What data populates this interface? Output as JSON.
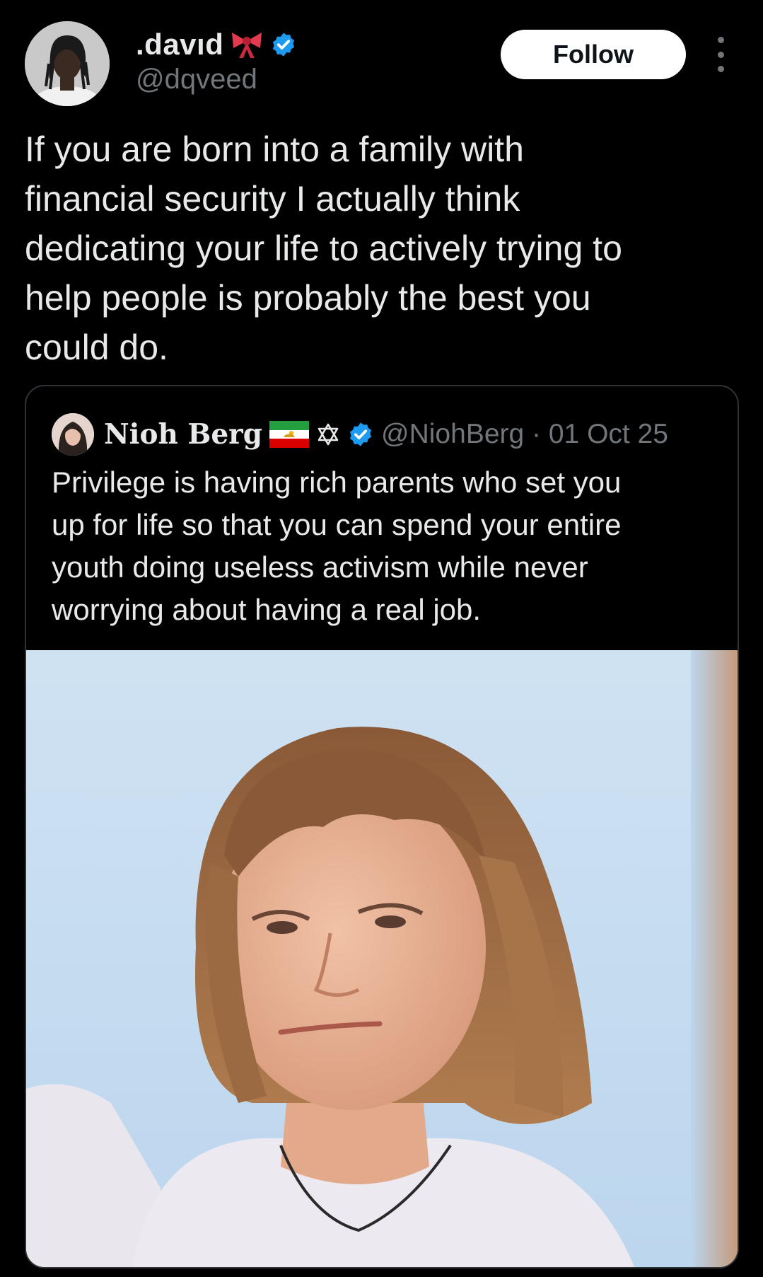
{
  "post": {
    "author": {
      "display_name": ".davıd",
      "handle": "@dqveed",
      "emoji_icon": "ribbon-bow-icon",
      "verified_icon": "verified-badge-icon"
    },
    "follow_label": "Follow",
    "more_icon": "more-vertical-icon",
    "text": "If you are born into a family with\nfinancial security I actually think\ndedicating your life to actively trying to\nhelp people is probably the best you\ncould do."
  },
  "quote": {
    "author": {
      "display_name": "Nioh Berg",
      "flag_icon": "iran-lion-sun-flag-icon",
      "symbol_icon": "star-of-david-icon",
      "verified_icon": "verified-badge-icon",
      "handle_and_date": "@NiohBerg · 01 Oct 25"
    },
    "text": "Privilege is having rich parents who set you\nup for life so that you can spend your entire\nyouth doing useless activism while never\nworrying about having a real job.",
    "image_icon": "photo-of-person-icon"
  },
  "colors": {
    "background": "#000000",
    "primary_text": "#e7e9ea",
    "secondary_text": "#71767b",
    "verified_blue": "#1d9bf0",
    "border": "#2f3336",
    "follow_button_bg": "#ffffff"
  }
}
